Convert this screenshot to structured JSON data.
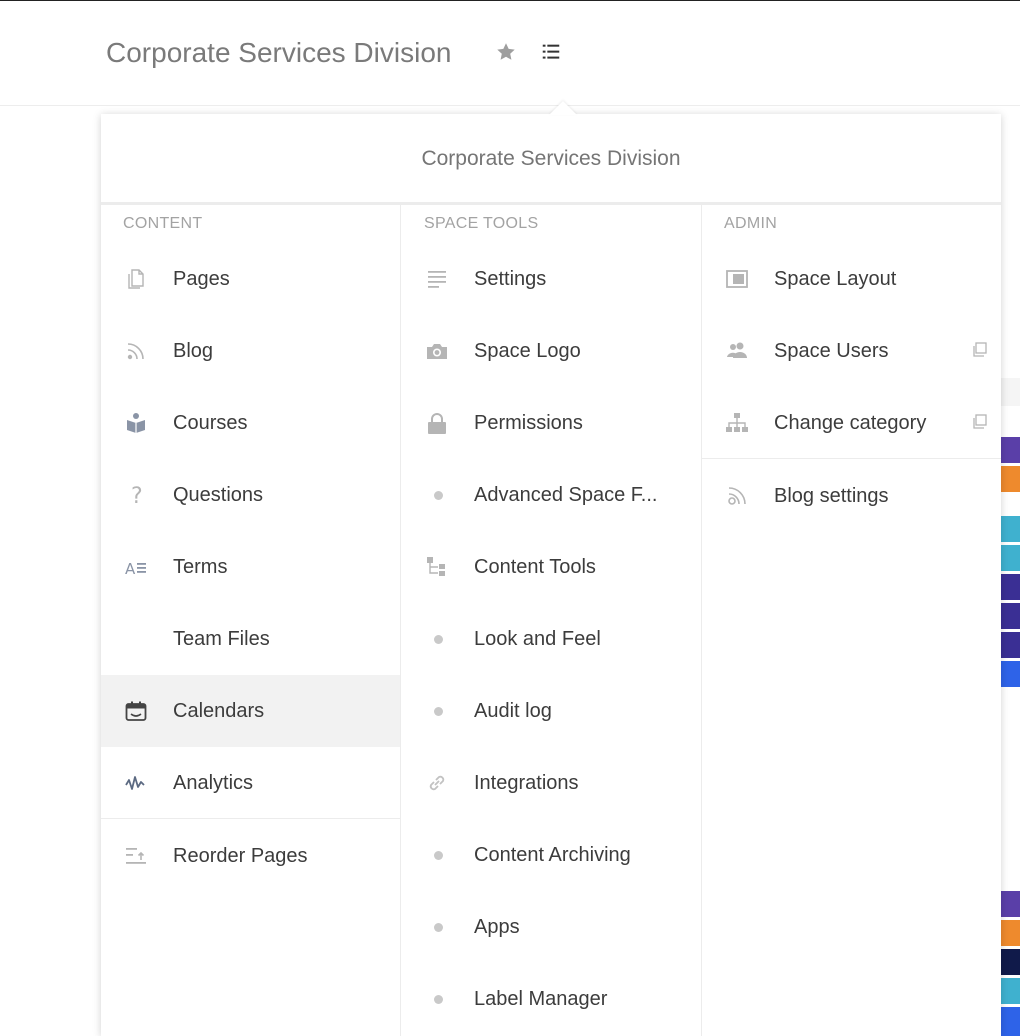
{
  "header": {
    "space_title": "Corporate Services Division"
  },
  "popup": {
    "title": "Corporate Services Division",
    "columns": [
      {
        "heading": "CONTENT",
        "items": [
          {
            "label": "Pages",
            "icon": "pages-icon"
          },
          {
            "label": "Blog",
            "icon": "rss-icon"
          },
          {
            "label": "Courses",
            "icon": "courses-icon"
          },
          {
            "label": "Questions",
            "icon": "question-icon"
          },
          {
            "label": "Terms",
            "icon": "terms-icon"
          },
          {
            "label": "Team Files",
            "icon": ""
          },
          {
            "label": "Calendars",
            "icon": "calendar-icon",
            "active": true
          },
          {
            "label": "Analytics",
            "icon": "analytics-icon"
          },
          {
            "label": "Reorder Pages",
            "icon": "reorder-icon"
          }
        ]
      },
      {
        "heading": "SPACE TOOLS",
        "items": [
          {
            "label": "Settings",
            "icon": "settings-lines-icon"
          },
          {
            "label": "Space Logo",
            "icon": "camera-icon"
          },
          {
            "label": "Permissions",
            "icon": "lock-icon"
          },
          {
            "label": "Advanced Space F...",
            "icon": "dot-icon"
          },
          {
            "label": "Content Tools",
            "icon": "content-tools-icon"
          },
          {
            "label": "Look and Feel",
            "icon": "dot-icon"
          },
          {
            "label": "Audit log",
            "icon": "dot-icon"
          },
          {
            "label": "Integrations",
            "icon": "link-icon"
          },
          {
            "label": "Content Archiving",
            "icon": "dot-icon"
          },
          {
            "label": "Apps",
            "icon": "dot-icon"
          },
          {
            "label": "Label Manager",
            "icon": "dot-icon"
          }
        ]
      },
      {
        "heading": "ADMIN",
        "items": [
          {
            "label": "Space Layout",
            "icon": "layout-icon"
          },
          {
            "label": "Space Users",
            "icon": "users-icon",
            "external": true
          },
          {
            "label": "Change category",
            "icon": "hierarchy-icon",
            "external": true
          },
          {
            "label": "Blog settings",
            "icon": "blog-settings-icon"
          }
        ]
      }
    ]
  },
  "colors": {
    "icon_gray": "#a8a8a8",
    "active_bg": "#f2f2f2",
    "purple": "#5a3fa8",
    "orange": "#ee8a2d",
    "teal": "#3fb1cf",
    "navy": "#101a4a",
    "blue": "#2e63e8"
  }
}
